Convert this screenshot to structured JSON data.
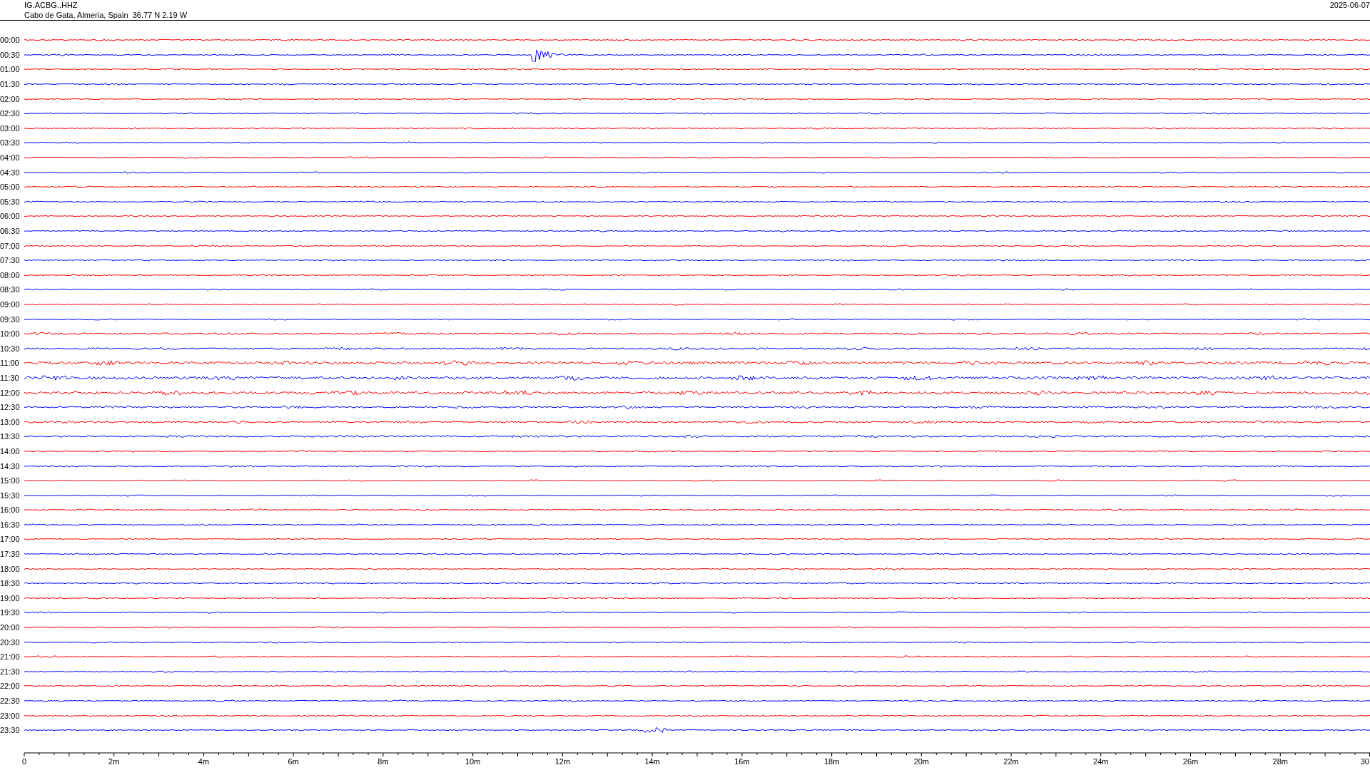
{
  "header": {
    "station": "IG.ACBG..HHZ",
    "location": "Cabo de Gata, Almeria, Spain  36.77 N 2.19 W",
    "date": "2025-06-07"
  },
  "traces": [
    {
      "time": "00:00",
      "color": "#ff0000"
    },
    {
      "time": "00:30",
      "color": "#0000ff"
    },
    {
      "time": "01:00",
      "color": "#ff0000"
    },
    {
      "time": "01:30",
      "color": "#0000ff"
    },
    {
      "time": "02:00",
      "color": "#ff0000"
    },
    {
      "time": "02:30",
      "color": "#0000ff"
    },
    {
      "time": "03:00",
      "color": "#ff0000"
    },
    {
      "time": "03:30",
      "color": "#0000ff"
    },
    {
      "time": "04:00",
      "color": "#ff0000"
    },
    {
      "time": "04:30",
      "color": "#0000ff"
    },
    {
      "time": "05:00",
      "color": "#ff0000"
    },
    {
      "time": "05:30",
      "color": "#0000ff"
    },
    {
      "time": "06:00",
      "color": "#ff0000"
    },
    {
      "time": "06:30",
      "color": "#0000ff"
    },
    {
      "time": "07:00",
      "color": "#ff0000"
    },
    {
      "time": "07:30",
      "color": "#0000ff"
    },
    {
      "time": "08:00",
      "color": "#ff0000"
    },
    {
      "time": "08:30",
      "color": "#0000ff"
    },
    {
      "time": "09:00",
      "color": "#ff0000"
    },
    {
      "time": "09:30",
      "color": "#0000ff"
    },
    {
      "time": "10:00",
      "color": "#ff0000"
    },
    {
      "time": "10:30",
      "color": "#0000ff"
    },
    {
      "time": "11:00",
      "color": "#ff0000"
    },
    {
      "time": "11:30",
      "color": "#0000ff"
    },
    {
      "time": "12:00",
      "color": "#ff0000"
    },
    {
      "time": "12:30",
      "color": "#0000ff"
    },
    {
      "time": "13:00",
      "color": "#ff0000"
    },
    {
      "time": "13:30",
      "color": "#0000ff"
    },
    {
      "time": "14:00",
      "color": "#ff0000"
    },
    {
      "time": "14:30",
      "color": "#0000ff"
    },
    {
      "time": "15:00",
      "color": "#ff0000"
    },
    {
      "time": "15:30",
      "color": "#0000ff"
    },
    {
      "time": "16:00",
      "color": "#ff0000"
    },
    {
      "time": "16:30",
      "color": "#0000ff"
    },
    {
      "time": "17:00",
      "color": "#ff0000"
    },
    {
      "time": "17:30",
      "color": "#0000ff"
    },
    {
      "time": "18:00",
      "color": "#ff0000"
    },
    {
      "time": "18:30",
      "color": "#0000ff"
    },
    {
      "time": "19:00",
      "color": "#ff0000"
    },
    {
      "time": "19:30",
      "color": "#0000ff"
    },
    {
      "time": "20:00",
      "color": "#ff0000"
    },
    {
      "time": "20:30",
      "color": "#0000ff"
    },
    {
      "time": "21:00",
      "color": "#ff0000"
    },
    {
      "time": "21:30",
      "color": "#0000ff"
    },
    {
      "time": "22:00",
      "color": "#ff0000"
    },
    {
      "time": "22:30",
      "color": "#0000ff"
    },
    {
      "time": "23:00",
      "color": "#ff0000"
    },
    {
      "time": "23:30",
      "color": "#0000ff"
    }
  ],
  "axis": {
    "labels": [
      "0",
      "2m",
      "4m",
      "6m",
      "8m",
      "10m",
      "12m",
      "14m",
      "16m",
      "18m",
      "20m",
      "22m",
      "24m",
      "26m",
      "28m",
      "30"
    ]
  }
}
